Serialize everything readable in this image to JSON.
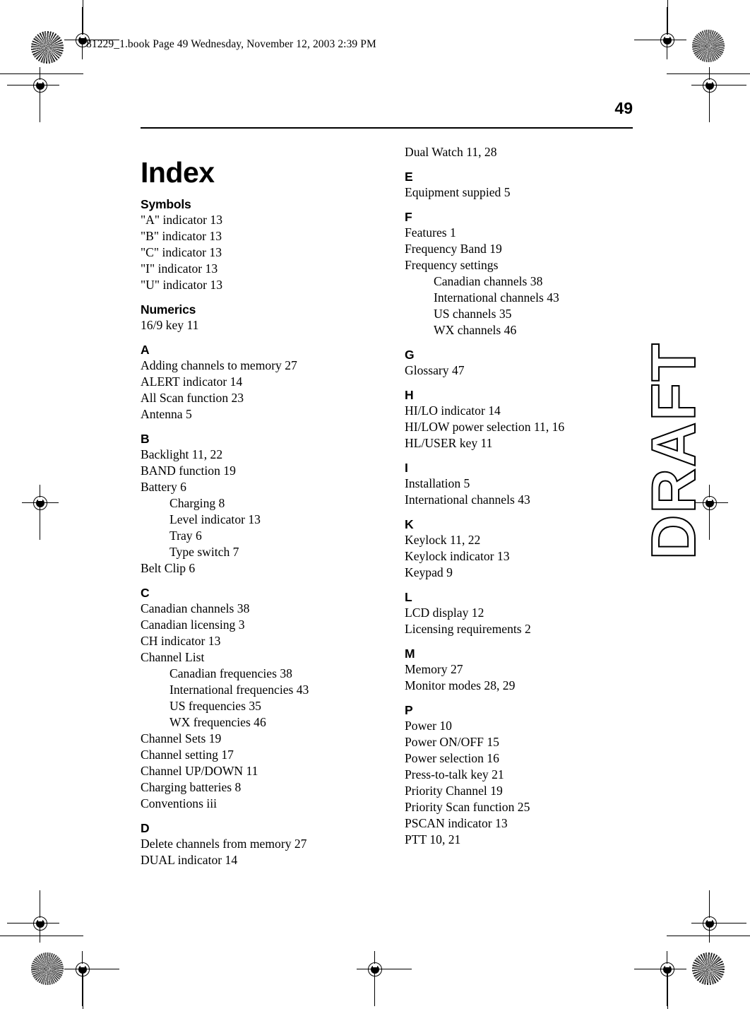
{
  "document": {
    "book_header": "81229_1.book  Page 49  Wednesday, November 12, 2003  2:39 PM",
    "page_number": "49",
    "title": "Index",
    "watermark": "DRAFT",
    "corner_code": "81229"
  },
  "columns": {
    "left": [
      {
        "heading": "Symbols",
        "entries": [
          {
            "text": "\"A\" indicator 13",
            "level": 0
          },
          {
            "text": "\"B\" indicator 13",
            "level": 0
          },
          {
            "text": "\"C\" indicator 13",
            "level": 0
          },
          {
            "text": "\"I\" indicator 13",
            "level": 0
          },
          {
            "text": "\"U\" indicator 13",
            "level": 0
          }
        ]
      },
      {
        "heading": "Numerics",
        "entries": [
          {
            "text": "16/9 key 11",
            "level": 0
          }
        ]
      },
      {
        "heading": "A",
        "entries": [
          {
            "text": "Adding channels to memory 27",
            "level": 0
          },
          {
            "text": "ALERT indicator 14",
            "level": 0
          },
          {
            "text": "All Scan function 23",
            "level": 0
          },
          {
            "text": "Antenna 5",
            "level": 0
          }
        ]
      },
      {
        "heading": "B",
        "entries": [
          {
            "text": "Backlight 11, 22",
            "level": 0
          },
          {
            "text": "BAND function 19",
            "level": 0
          },
          {
            "text": "Battery 6",
            "level": 0
          },
          {
            "text": "Charging 8",
            "level": 1
          },
          {
            "text": "Level indicator 13",
            "level": 1
          },
          {
            "text": "Tray 6",
            "level": 1
          },
          {
            "text": "Type switch 7",
            "level": 1
          },
          {
            "text": "Belt Clip 6",
            "level": 0
          }
        ]
      },
      {
        "heading": "C",
        "entries": [
          {
            "text": "Canadian channels 38",
            "level": 0
          },
          {
            "text": "Canadian licensing 3",
            "level": 0
          },
          {
            "text": "CH indicator 13",
            "level": 0
          },
          {
            "text": "Channel List",
            "level": 0
          },
          {
            "text": "Canadian frequencies 38",
            "level": 1
          },
          {
            "text": "International frequencies 43",
            "level": 1
          },
          {
            "text": "US frequencies 35",
            "level": 1
          },
          {
            "text": "WX frequencies 46",
            "level": 1
          },
          {
            "text": "Channel Sets 19",
            "level": 0
          },
          {
            "text": "Channel setting 17",
            "level": 0
          },
          {
            "text": "Channel UP/DOWN 11",
            "level": 0
          },
          {
            "text": "Charging batteries 8",
            "level": 0
          },
          {
            "text": "Conventions iii",
            "level": 0
          }
        ]
      },
      {
        "heading": "D",
        "entries": [
          {
            "text": "Delete channels from memory 27",
            "level": 0
          },
          {
            "text": "DUAL indicator 14",
            "level": 0
          }
        ]
      }
    ],
    "right": [
      {
        "heading": "",
        "entries": [
          {
            "text": "Dual Watch 11, 28",
            "level": 0
          }
        ]
      },
      {
        "heading": "E",
        "entries": [
          {
            "text": "Equipment suppied 5",
            "level": 0
          }
        ]
      },
      {
        "heading": "F",
        "entries": [
          {
            "text": "Features 1",
            "level": 0
          },
          {
            "text": "Frequency Band 19",
            "level": 0
          },
          {
            "text": "Frequency settings",
            "level": 0
          },
          {
            "text": "Canadian channels 38",
            "level": 1
          },
          {
            "text": "International channels 43",
            "level": 1
          },
          {
            "text": "US channels 35",
            "level": 1
          },
          {
            "text": "WX channels 46",
            "level": 1
          }
        ]
      },
      {
        "heading": "G",
        "entries": [
          {
            "text": "Glossary 47",
            "level": 0
          }
        ]
      },
      {
        "heading": "H",
        "entries": [
          {
            "text": "HI/LO indicator 14",
            "level": 0
          },
          {
            "text": "HI/LOW power selection 11, 16",
            "level": 0
          },
          {
            "text": "HL/USER key 11",
            "level": 0
          }
        ]
      },
      {
        "heading": "I",
        "entries": [
          {
            "text": "Installation 5",
            "level": 0
          },
          {
            "text": "International channels 43",
            "level": 0
          }
        ]
      },
      {
        "heading": "K",
        "entries": [
          {
            "text": "Keylock 11, 22",
            "level": 0
          },
          {
            "text": "Keylock indicator 13",
            "level": 0
          },
          {
            "text": "Keypad 9",
            "level": 0
          }
        ]
      },
      {
        "heading": "L",
        "entries": [
          {
            "text": "LCD display 12",
            "level": 0
          },
          {
            "text": "Licensing requirements 2",
            "level": 0
          }
        ]
      },
      {
        "heading": "M",
        "entries": [
          {
            "text": "Memory 27",
            "level": 0
          },
          {
            "text": "Monitor modes 28, 29",
            "level": 0
          }
        ]
      },
      {
        "heading": "P",
        "entries": [
          {
            "text": "Power 10",
            "level": 0
          },
          {
            "text": "Power ON/OFF 15",
            "level": 0
          },
          {
            "text": "Power selection 16",
            "level": 0
          },
          {
            "text": "Press-to-talk key 21",
            "level": 0
          },
          {
            "text": "Priority Channel 19",
            "level": 0
          },
          {
            "text": "Priority Scan function 25",
            "level": 0
          },
          {
            "text": "PSCAN indicator 13",
            "level": 0
          },
          {
            "text": "PTT 10, 21",
            "level": 0
          }
        ]
      }
    ]
  }
}
